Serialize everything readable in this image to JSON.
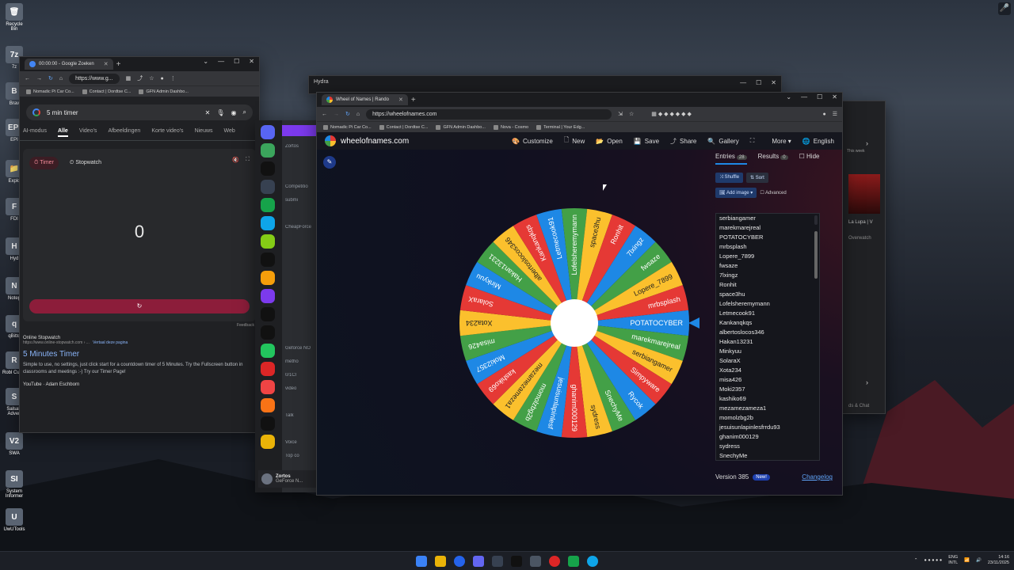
{
  "desktop": {
    "icons": [
      {
        "label": "Recycle Bin",
        "glyph": "🗑"
      },
      {
        "label": "7z",
        "glyph": "7z"
      },
      {
        "label": "Brav",
        "glyph": "B"
      },
      {
        "label": "EPI",
        "glyph": "EPI"
      },
      {
        "label": "Explo",
        "glyph": "📁"
      },
      {
        "label": "FDI",
        "glyph": "F"
      },
      {
        "label": "Hyd",
        "glyph": "H"
      },
      {
        "label": "Notep",
        "glyph": "N"
      },
      {
        "label": "qBitto",
        "glyph": "q"
      },
      {
        "label": "Robl Curso",
        "glyph": "R"
      },
      {
        "label": "SalsaN Adven",
        "glyph": "S"
      },
      {
        "label": "SWA",
        "glyph": "V2"
      },
      {
        "label": "System Informer",
        "glyph": "SI"
      },
      {
        "label": "UwUTools",
        "glyph": "U"
      }
    ]
  },
  "google_window": {
    "tab_title": "00:00:00 - Google Zoeken",
    "url": "https://www.g...",
    "bookmarks": [
      "Nomadic Pi Car Co...",
      "Contact | Dordtse C...",
      "GFN Admin Dashbo..."
    ],
    "search_query": "5 min timer",
    "tabs": [
      "AI-modus",
      "Alle",
      "Video's",
      "Afbeeldingen",
      "Korte video's",
      "Nieuws",
      "Web"
    ],
    "active_tab": "Alle",
    "timer_tab": "Timer",
    "stopwatch_tab": "Stopwatch",
    "timer_value": "0",
    "reset_glyph": "↻",
    "feedback": "Feedback",
    "result": {
      "site": "Online Stopwatch",
      "url": "https://www.online-stopwatch.com › ...",
      "translate": "Vertaal deze pagina",
      "title": "5 Minutes Timer",
      "snippet": "Simple to use, no settings, just click start for a countdown timer of 5 Minutes. Try the Fullscreen button in classrooms and meetings :-) Try our Timer Page!",
      "next": "YouTube · Adam Eschborn"
    }
  },
  "discord": {
    "channels": [
      "Zortos",
      "",
      "",
      "Competitio",
      "submi",
      "",
      "CheapForce",
      "",
      "",
      "",
      "",
      "",
      "",
      "",
      "",
      "Geforce NO",
      "metho",
      "0/1Cl",
      "video",
      "",
      "Talk",
      "",
      "Voice",
      "Top co"
    ],
    "user": "Zortos",
    "user_status": "GeForce N..."
  },
  "hydra": {
    "title": "Hydra"
  },
  "right_window": {
    "card_title": "La Lupa | V",
    "card_sub": "Overwatch",
    "this_week": "This week",
    "footer": "ds & Chat"
  },
  "wheel_window": {
    "tab_title": "Wheel of Names | Rando",
    "url": "https://wheelofnames.com",
    "bookmarks": [
      "Nomadic Pi Car Co...",
      "Contact | Dordtse C...",
      "GFN Admin Dashbo...",
      "Nova - Cosmo",
      "Terminal | Your Edg..."
    ],
    "brand": "wheelofnames.com",
    "menu": [
      {
        "label": "Customize",
        "icon": "🎨"
      },
      {
        "label": "New",
        "icon": "🗋"
      },
      {
        "label": "Open",
        "icon": "📂"
      },
      {
        "label": "Save",
        "icon": "💾"
      },
      {
        "label": "Share",
        "icon": "⤴"
      },
      {
        "label": "Gallery",
        "icon": "🔍"
      },
      {
        "label": "",
        "icon": "⛶"
      },
      {
        "label": "More ▾",
        "icon": ""
      },
      {
        "label": "English",
        "icon": "🌐"
      }
    ],
    "entries_tab": "Entries",
    "entries_count": "28",
    "results_tab": "Results",
    "results_count": "0",
    "hide_label": "Hide",
    "shuffle": "Shuffle",
    "sort": "Sort",
    "add_image": "Add image ▾",
    "advanced": "Advanced",
    "entries": [
      "serbiangamer",
      "marekmarejreal",
      "POTATOCYBER",
      "mrbsplash",
      "Lopere_7899",
      "fwsaze",
      "7lxingz",
      "Ronhit",
      "space3hu",
      "Lofelsheremymann",
      "Letmecook91",
      "Kankanqkqs",
      "albertoslocos346",
      "Hakan13231",
      "Minkyuu",
      "SolaraX",
      "Xota234",
      "misa426",
      "Moki2357",
      "kashiko69",
      "mezamezameza1",
      "momolzbg2b",
      "jesuisunlapinlesfrrdu93",
      "ghanim000129",
      "sydress",
      "SnechyMe"
    ],
    "wheel_labels": [
      "POTATOCYBER",
      "marekmarejreal",
      "serbiangamer",
      "Simpyware",
      "Rycok",
      "SnechyMe",
      "sydress",
      "ghanim000129",
      "jesuisunlapinlesf",
      "momolzbg2b",
      "mezamezameza1",
      "kashiko69",
      "Moki2357",
      "misa426",
      "Xota234",
      "SolaraX",
      "Minkyuu",
      "Hakan13231",
      "albertoslocos346",
      "Kankanqkqs",
      "Letmecook91",
      "Lofelsheremymann",
      "space3hu",
      "Ronhit",
      "7lxingz",
      "fwsaze",
      "Lopere_7899",
      "mrbsplash"
    ],
    "wheel_colors": [
      "#1e88e5",
      "#43a047",
      "#fbc02d",
      "#e53935"
    ],
    "version": "Version 385",
    "new_badge": "New!",
    "changelog": "Changelog"
  },
  "taskbar": {
    "lang": "ENG",
    "lang_sub": "INTL",
    "time": "14:16",
    "date": "23/11/2025"
  }
}
